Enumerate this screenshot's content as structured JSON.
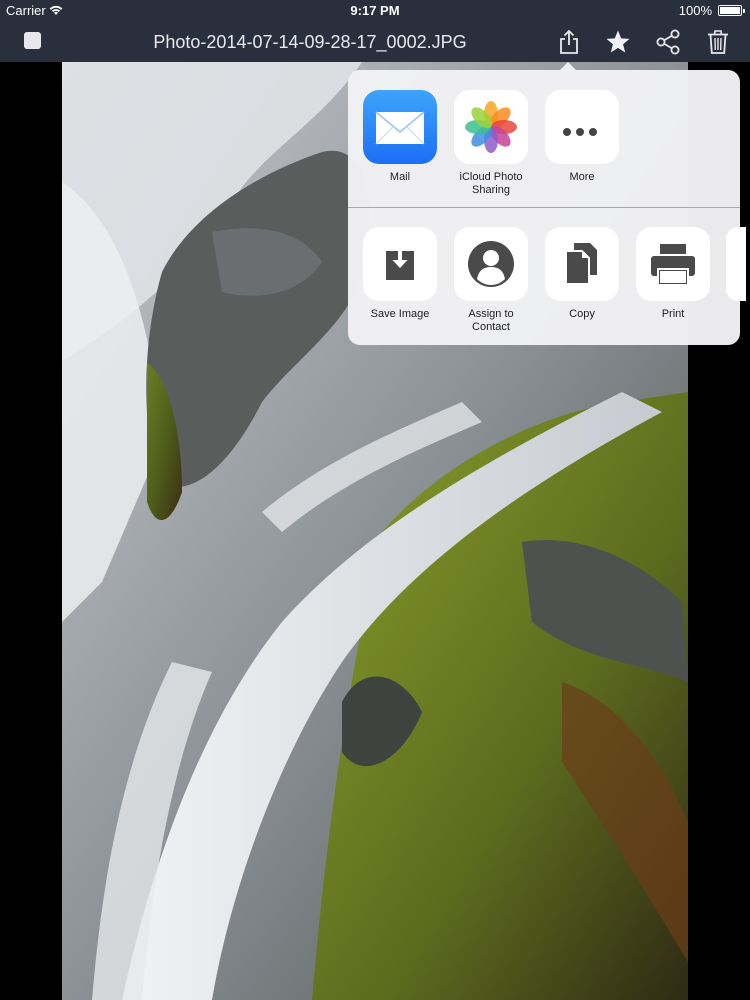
{
  "status_bar": {
    "carrier": "Carrier",
    "time": "9:17 PM",
    "battery_percent": "100%",
    "wifi_icon": "wifi-icon",
    "battery_icon": "battery-icon"
  },
  "nav_bar": {
    "title": "Photo-2014-07-14-09-28-17_0002.JPG",
    "stop_icon": "stop-square-icon",
    "share_icon": "share-icon",
    "favorite_icon": "star-icon",
    "social_share_icon": "share-network-icon",
    "trash_icon": "trash-icon"
  },
  "share_sheet": {
    "share_targets": [
      {
        "label_lines": [
          "Mail"
        ],
        "icon": "mail-icon"
      },
      {
        "label_lines": [
          "iCloud Photo",
          "Sharing"
        ],
        "icon": "photos-icon"
      },
      {
        "label_lines": [
          "More"
        ],
        "icon": "more-icon"
      }
    ],
    "actions": [
      {
        "label_lines": [
          "Save Image"
        ],
        "icon": "save-image-icon"
      },
      {
        "label_lines": [
          "Assign to",
          "Contact"
        ],
        "icon": "contact-icon"
      },
      {
        "label_lines": [
          "Copy"
        ],
        "icon": "copy-icon"
      },
      {
        "label_lines": [
          "Print"
        ],
        "icon": "print-icon"
      }
    ]
  },
  "colors": {
    "bar_background": "#2a2f3d",
    "sheet_background": "#f2f2f4",
    "mail_gradient_top": "#3ea4fb",
    "mail_gradient_bottom": "#1d6ef5"
  }
}
